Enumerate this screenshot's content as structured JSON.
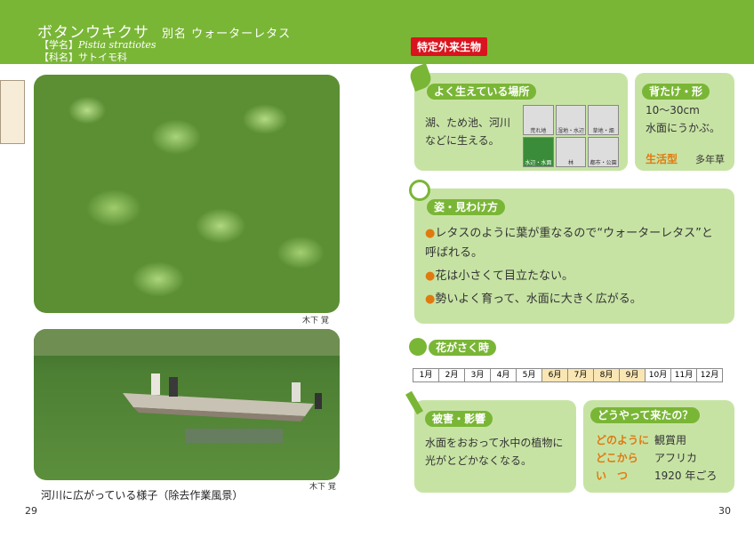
{
  "header": {
    "title": "ボタンウキクサ",
    "alias": "別名 ウォーターレタス",
    "scientific_label": "【学名】",
    "scientific_name": "Pistia stratiotes",
    "family_label": "【科名】サトイモ科",
    "badge": "特定外来生物"
  },
  "photos": {
    "credit1": "木下 覚",
    "credit2": "木下 覚",
    "caption": "河川に広がっている様子（除去作業風景）"
  },
  "pages": {
    "left": "29",
    "right": "30"
  },
  "habitat": {
    "title": "よく生えている場所",
    "text1": "湖、ため池、河川",
    "text2": "などに生える。",
    "icons": [
      {
        "label": "荒れ地",
        "on": false
      },
      {
        "label": "湿地・水辺",
        "on": false
      },
      {
        "label": "草地・畑",
        "on": false
      },
      {
        "label": "水辺・水面",
        "on": true
      },
      {
        "label": "林",
        "on": false
      },
      {
        "label": "都市・公園",
        "on": false
      }
    ]
  },
  "height": {
    "title": "背たけ・形",
    "size": "10〜30cm",
    "shape": "水面にうかぶ。",
    "life_label": "生活型",
    "life_value": "多年草"
  },
  "features": {
    "title": "姿・見わけ方",
    "items": [
      "レタスのように葉が重なるので“ウォーターレタス”と呼ばれる。",
      "花は小さくて目立たない。",
      "勢いよく育って、水面に大きく広がる。"
    ]
  },
  "bloom": {
    "title": "花がさく時",
    "months": [
      "1月",
      "2月",
      "3月",
      "4月",
      "5月",
      "6月",
      "7月",
      "8月",
      "9月",
      "10月",
      "11月",
      "12月"
    ],
    "highlight_from": 6,
    "highlight_to": 9
  },
  "damage": {
    "title": "被害・影響",
    "text1": "水面をおおって水中の植物に",
    "text2": "光がとどかなくなる。"
  },
  "origin": {
    "title": "どうやって来たの？",
    "how_label": "どのように",
    "how_value": "観賞用",
    "where_label": "どこから",
    "where_value": "アフリカ",
    "when_label": "い　つ",
    "when_value": "1920 年ごろ"
  }
}
